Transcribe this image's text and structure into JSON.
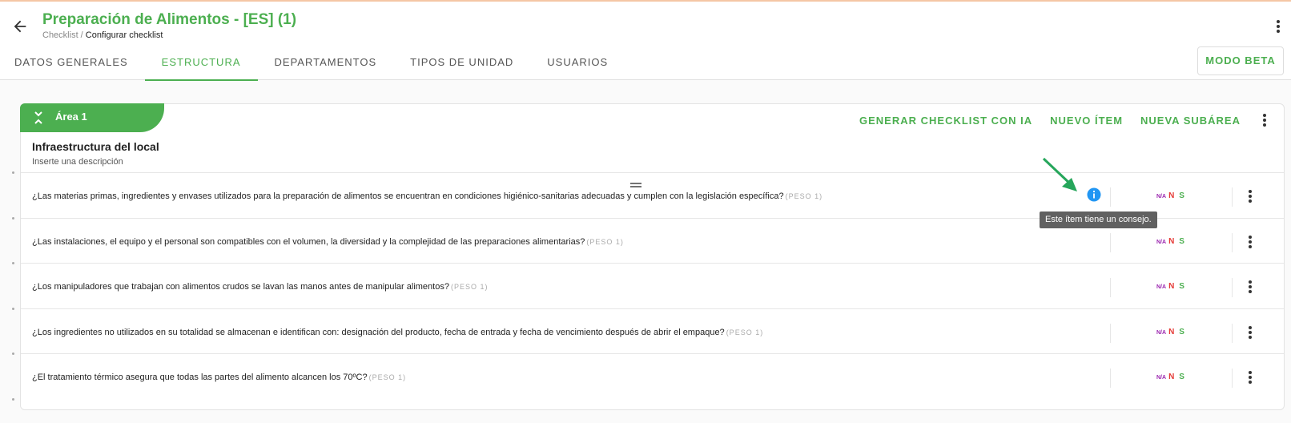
{
  "header": {
    "title": "Preparación de Alimentos - [ES] (1)",
    "breadcrumb_parent": "Checklist",
    "breadcrumb_separator": " / ",
    "breadcrumb_current": "Configurar checklist"
  },
  "tabs": [
    {
      "label": "DATOS GENERALES"
    },
    {
      "label": "ESTRUCTURA"
    },
    {
      "label": "DEPARTAMENTOS"
    },
    {
      "label": "TIPOS DE UNIDAD"
    },
    {
      "label": "USUARIOS"
    }
  ],
  "beta_button": "MODO BETA",
  "area": {
    "label": "Área 1",
    "actions": [
      "GENERAR CHECKLIST CON IA",
      "NUEVO ÍTEM",
      "NUEVA SUBÁREA"
    ],
    "section_title": "Infraestructura del local",
    "section_description": "Inserte una descripción"
  },
  "answers": {
    "na": "N/A",
    "n": "N",
    "s": "S"
  },
  "questions": [
    {
      "text": "¿Las materias primas, ingredientes y envases utilizados para la preparación de alimentos se encuentran en condiciones higiénico-sanitarias adecuadas y cumplen con la legislación específica?",
      "peso": "(PESO 1)"
    },
    {
      "text": "¿Las instalaciones, el equipo y el personal son compatibles con el volumen, la diversidad y la complejidad de las preparaciones alimentarias?",
      "peso": "(PESO 1)"
    },
    {
      "text": "¿Los manipuladores que trabajan con alimentos crudos se lavan las manos antes de manipular alimentos?",
      "peso": "(PESO 1)"
    },
    {
      "text": "¿Los ingredientes no utilizados en su totalidad se almacenan e identifican con: designación del producto, fecha de entrada y fecha de vencimiento después de abrir el empaque?",
      "peso": "(PESO 1)"
    },
    {
      "text": "¿El tratamiento térmico asegura que todas las partes del alimento alcancen los 70ºC?",
      "peso": "(PESO 1)"
    }
  ],
  "tooltip": "Este ítem tiene un consejo.",
  "colors": {
    "brand": "#4caf50",
    "info": "#2196f3",
    "na": "#9c27b0",
    "no": "#e53935"
  }
}
